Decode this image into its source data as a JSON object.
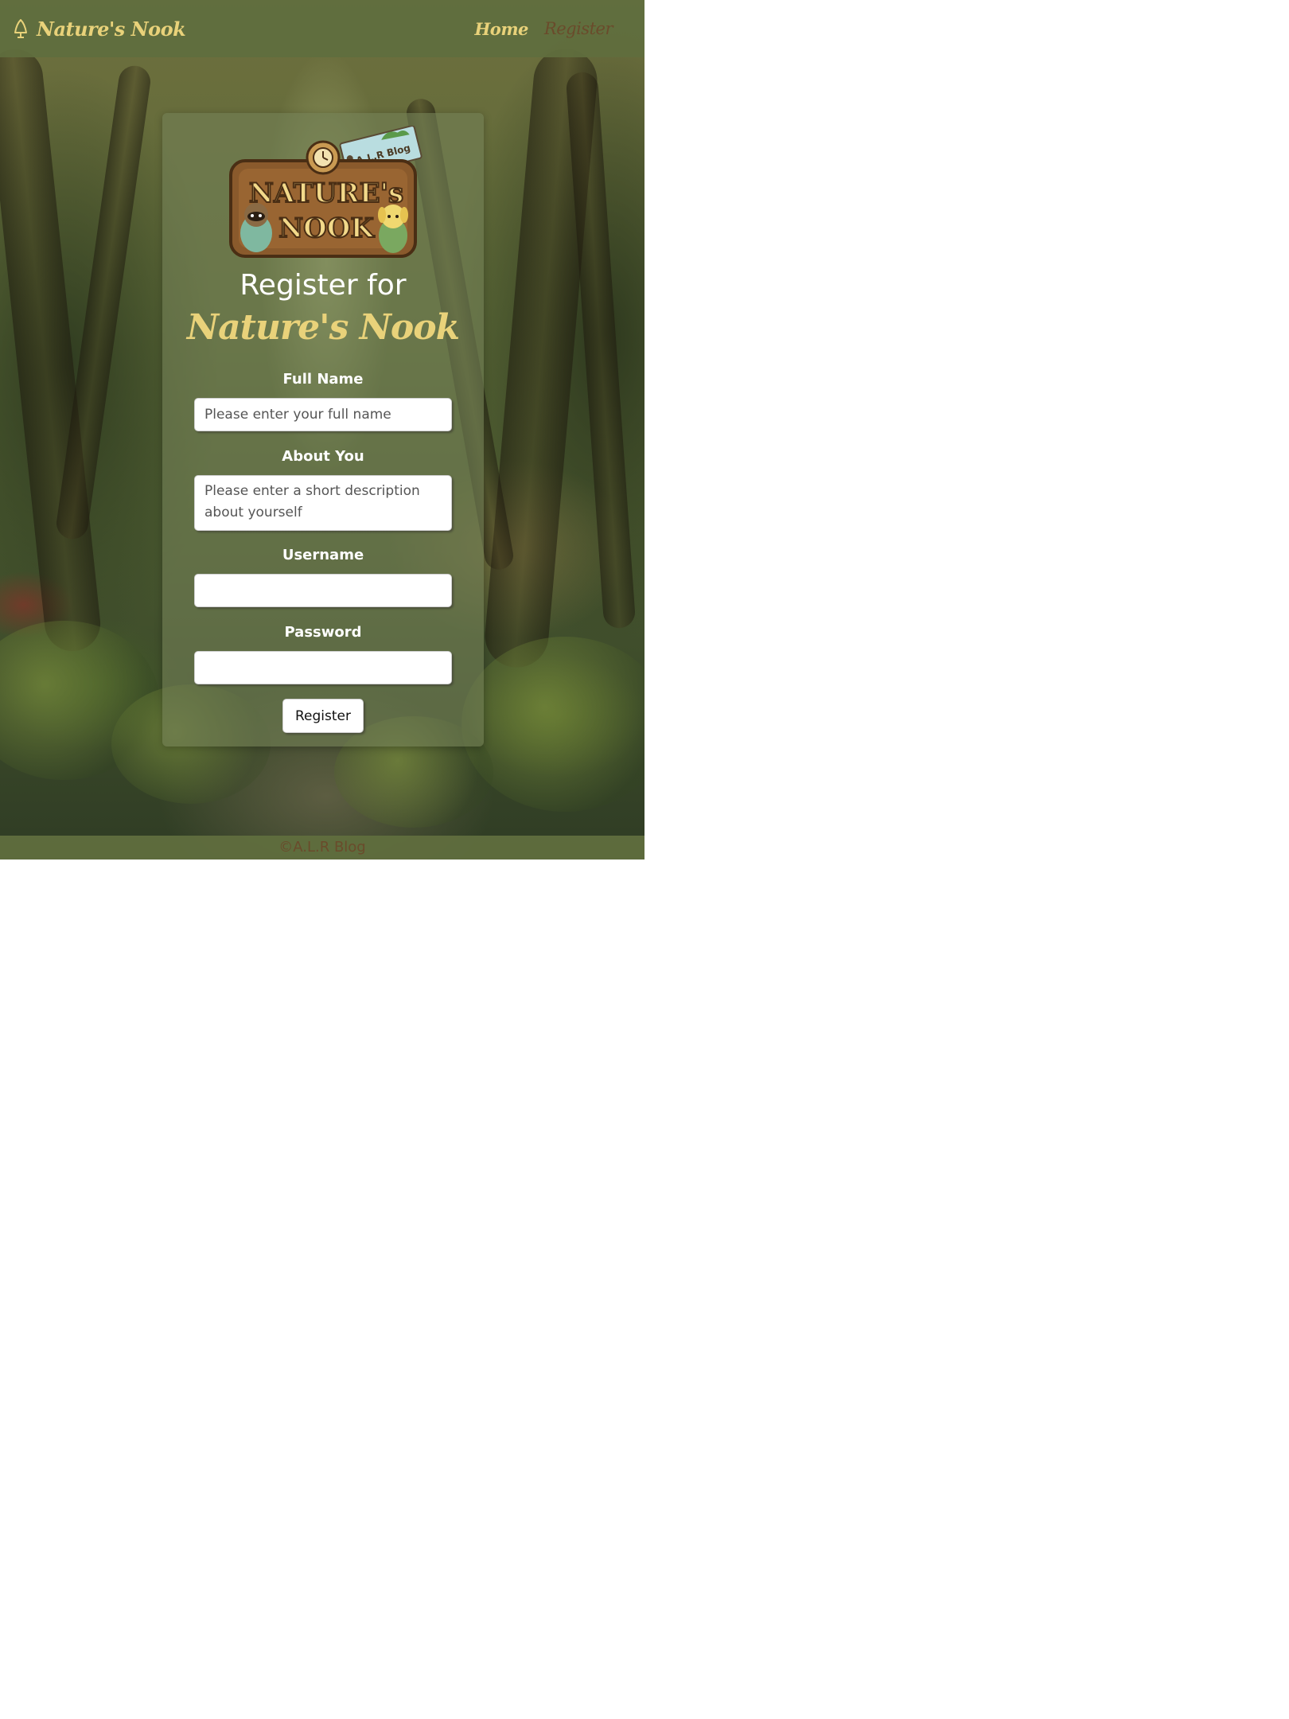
{
  "navbar": {
    "brand_name": "Nature's Nook",
    "brand_icon": "tree-icon",
    "links": [
      {
        "label": "Home"
      },
      {
        "label": "Register"
      }
    ]
  },
  "logo": {
    "line1": "NATURE's",
    "line2": "NOOK",
    "tag_text": "A.L.R Blog"
  },
  "form": {
    "heading": "Register for",
    "heading_brand": "Nature's Nook",
    "full_name": {
      "label": "Full Name",
      "placeholder": "Please enter your full name",
      "value": ""
    },
    "about": {
      "label": "About You",
      "placeholder": "Please enter a short description about yourself",
      "value": ""
    },
    "username": {
      "label": "Username",
      "value": ""
    },
    "password": {
      "label": "Password",
      "value": ""
    },
    "submit_label": "Register"
  },
  "footer": {
    "text": "©A.L.R Blog"
  },
  "colors": {
    "brand_yellow": "#e9d27a",
    "brand_brown": "#6a4b2b",
    "navbar_green": "#606e3e"
  }
}
